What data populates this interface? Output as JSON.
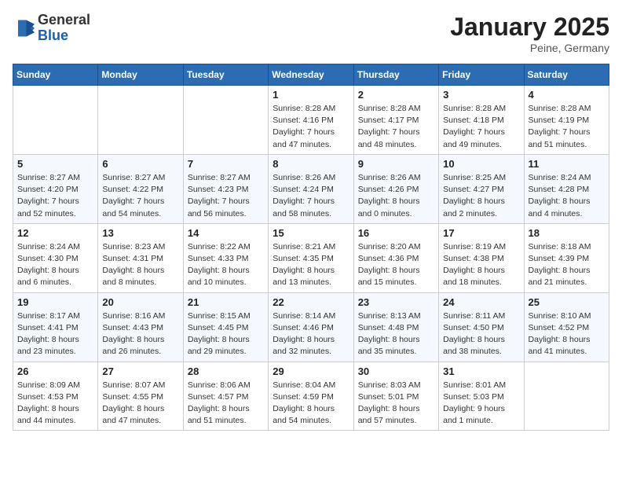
{
  "header": {
    "logo_general": "General",
    "logo_blue": "Blue",
    "month": "January 2025",
    "location": "Peine, Germany"
  },
  "days_of_week": [
    "Sunday",
    "Monday",
    "Tuesday",
    "Wednesday",
    "Thursday",
    "Friday",
    "Saturday"
  ],
  "weeks": [
    [
      {
        "day": "",
        "info": ""
      },
      {
        "day": "",
        "info": ""
      },
      {
        "day": "",
        "info": ""
      },
      {
        "day": "1",
        "info": "Sunrise: 8:28 AM\nSunset: 4:16 PM\nDaylight: 7 hours and 47 minutes."
      },
      {
        "day": "2",
        "info": "Sunrise: 8:28 AM\nSunset: 4:17 PM\nDaylight: 7 hours and 48 minutes."
      },
      {
        "day": "3",
        "info": "Sunrise: 8:28 AM\nSunset: 4:18 PM\nDaylight: 7 hours and 49 minutes."
      },
      {
        "day": "4",
        "info": "Sunrise: 8:28 AM\nSunset: 4:19 PM\nDaylight: 7 hours and 51 minutes."
      }
    ],
    [
      {
        "day": "5",
        "info": "Sunrise: 8:27 AM\nSunset: 4:20 PM\nDaylight: 7 hours and 52 minutes."
      },
      {
        "day": "6",
        "info": "Sunrise: 8:27 AM\nSunset: 4:22 PM\nDaylight: 7 hours and 54 minutes."
      },
      {
        "day": "7",
        "info": "Sunrise: 8:27 AM\nSunset: 4:23 PM\nDaylight: 7 hours and 56 minutes."
      },
      {
        "day": "8",
        "info": "Sunrise: 8:26 AM\nSunset: 4:24 PM\nDaylight: 7 hours and 58 minutes."
      },
      {
        "day": "9",
        "info": "Sunrise: 8:26 AM\nSunset: 4:26 PM\nDaylight: 8 hours and 0 minutes."
      },
      {
        "day": "10",
        "info": "Sunrise: 8:25 AM\nSunset: 4:27 PM\nDaylight: 8 hours and 2 minutes."
      },
      {
        "day": "11",
        "info": "Sunrise: 8:24 AM\nSunset: 4:28 PM\nDaylight: 8 hours and 4 minutes."
      }
    ],
    [
      {
        "day": "12",
        "info": "Sunrise: 8:24 AM\nSunset: 4:30 PM\nDaylight: 8 hours and 6 minutes."
      },
      {
        "day": "13",
        "info": "Sunrise: 8:23 AM\nSunset: 4:31 PM\nDaylight: 8 hours and 8 minutes."
      },
      {
        "day": "14",
        "info": "Sunrise: 8:22 AM\nSunset: 4:33 PM\nDaylight: 8 hours and 10 minutes."
      },
      {
        "day": "15",
        "info": "Sunrise: 8:21 AM\nSunset: 4:35 PM\nDaylight: 8 hours and 13 minutes."
      },
      {
        "day": "16",
        "info": "Sunrise: 8:20 AM\nSunset: 4:36 PM\nDaylight: 8 hours and 15 minutes."
      },
      {
        "day": "17",
        "info": "Sunrise: 8:19 AM\nSunset: 4:38 PM\nDaylight: 8 hours and 18 minutes."
      },
      {
        "day": "18",
        "info": "Sunrise: 8:18 AM\nSunset: 4:39 PM\nDaylight: 8 hours and 21 minutes."
      }
    ],
    [
      {
        "day": "19",
        "info": "Sunrise: 8:17 AM\nSunset: 4:41 PM\nDaylight: 8 hours and 23 minutes."
      },
      {
        "day": "20",
        "info": "Sunrise: 8:16 AM\nSunset: 4:43 PM\nDaylight: 8 hours and 26 minutes."
      },
      {
        "day": "21",
        "info": "Sunrise: 8:15 AM\nSunset: 4:45 PM\nDaylight: 8 hours and 29 minutes."
      },
      {
        "day": "22",
        "info": "Sunrise: 8:14 AM\nSunset: 4:46 PM\nDaylight: 8 hours and 32 minutes."
      },
      {
        "day": "23",
        "info": "Sunrise: 8:13 AM\nSunset: 4:48 PM\nDaylight: 8 hours and 35 minutes."
      },
      {
        "day": "24",
        "info": "Sunrise: 8:11 AM\nSunset: 4:50 PM\nDaylight: 8 hours and 38 minutes."
      },
      {
        "day": "25",
        "info": "Sunrise: 8:10 AM\nSunset: 4:52 PM\nDaylight: 8 hours and 41 minutes."
      }
    ],
    [
      {
        "day": "26",
        "info": "Sunrise: 8:09 AM\nSunset: 4:53 PM\nDaylight: 8 hours and 44 minutes."
      },
      {
        "day": "27",
        "info": "Sunrise: 8:07 AM\nSunset: 4:55 PM\nDaylight: 8 hours and 47 minutes."
      },
      {
        "day": "28",
        "info": "Sunrise: 8:06 AM\nSunset: 4:57 PM\nDaylight: 8 hours and 51 minutes."
      },
      {
        "day": "29",
        "info": "Sunrise: 8:04 AM\nSunset: 4:59 PM\nDaylight: 8 hours and 54 minutes."
      },
      {
        "day": "30",
        "info": "Sunrise: 8:03 AM\nSunset: 5:01 PM\nDaylight: 8 hours and 57 minutes."
      },
      {
        "day": "31",
        "info": "Sunrise: 8:01 AM\nSunset: 5:03 PM\nDaylight: 9 hours and 1 minute."
      },
      {
        "day": "",
        "info": ""
      }
    ]
  ]
}
